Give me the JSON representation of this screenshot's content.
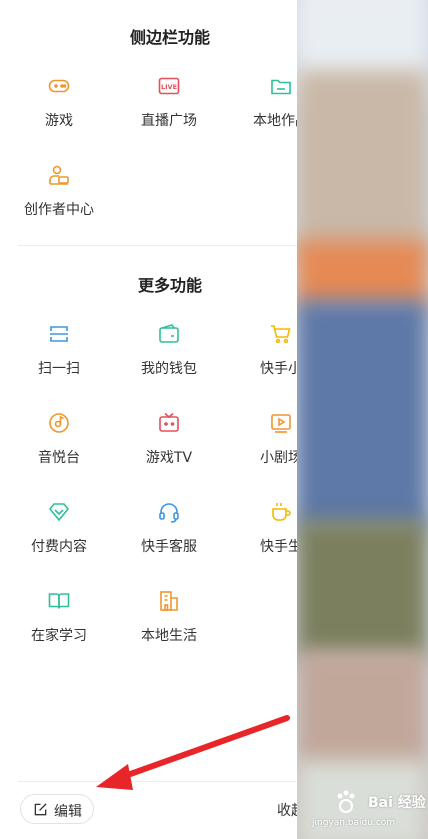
{
  "sections": {
    "sidebar": {
      "title": "侧边栏功能",
      "items": [
        {
          "label": "游戏",
          "icon": "gamepad-icon",
          "color": "#f0962d"
        },
        {
          "label": "直播广场",
          "icon": "live-icon",
          "color": "#e5505a"
        },
        {
          "label": "本地作品",
          "icon": "folder-icon",
          "color": "#2fbf9a"
        },
        {
          "label": "创作者中心",
          "icon": "creator-icon",
          "color": "#f0962d"
        }
      ]
    },
    "more": {
      "title": "更多功能",
      "items": [
        {
          "label": "扫一扫",
          "icon": "scan-icon",
          "color": "#3b95e6"
        },
        {
          "label": "我的钱包",
          "icon": "wallet-icon",
          "color": "#2fbf9a"
        },
        {
          "label": "快手小",
          "icon": "cart-icon",
          "color": "#f5b800"
        },
        {
          "label": "音悦台",
          "icon": "music-disc-icon",
          "color": "#f0962d"
        },
        {
          "label": "游戏TV",
          "icon": "tv-icon",
          "color": "#e5505a"
        },
        {
          "label": "小剧场",
          "icon": "play-screen-icon",
          "color": "#f0962d"
        },
        {
          "label": "付费内容",
          "icon": "diamond-icon",
          "color": "#2fbf9a"
        },
        {
          "label": "快手客服",
          "icon": "headset-icon",
          "color": "#3b95e6"
        },
        {
          "label": "快手生",
          "icon": "cup-icon",
          "color": "#f5b800"
        },
        {
          "label": "在家学习",
          "icon": "book-icon",
          "color": "#2fbf9a"
        },
        {
          "label": "本地生活",
          "icon": "building-icon",
          "color": "#f0962d"
        }
      ]
    }
  },
  "bottom": {
    "edit_label": "编辑",
    "edit_icon": "edit-icon",
    "collapse_label": "收起"
  },
  "watermark": {
    "text": "Bai 经验",
    "url": "jingyan.baidu.com"
  },
  "colors": {
    "annotation_arrow": "#e8262a",
    "text_primary": "#333333"
  }
}
